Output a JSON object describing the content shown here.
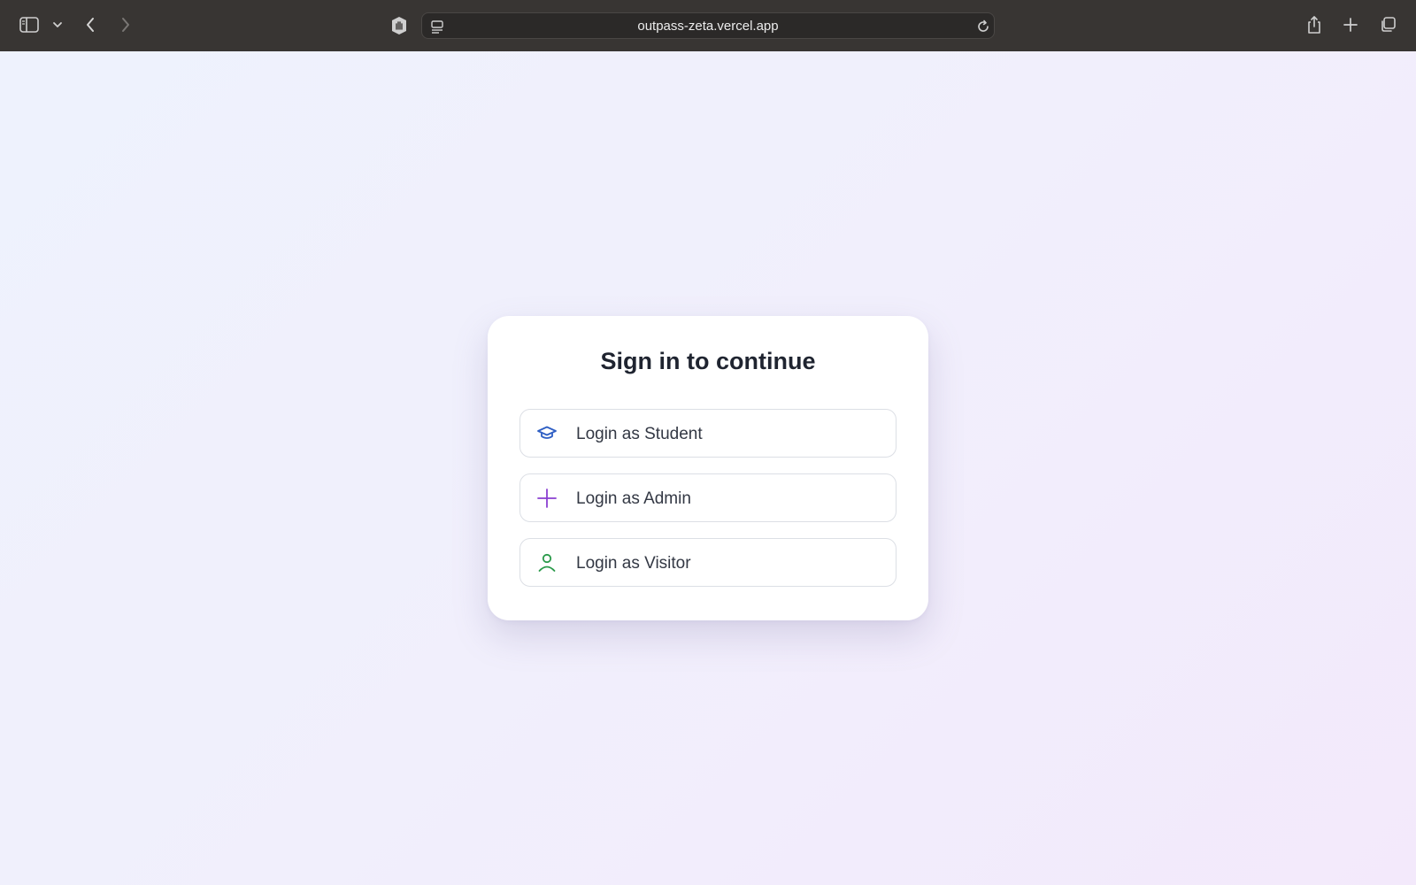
{
  "browser": {
    "url": "outpass-zeta.vercel.app",
    "icons": {
      "sidebar": "sidebar-icon",
      "sidebar_menu": "chevron-down-icon",
      "back": "back-arrow-icon",
      "forward": "forward-arrow-icon",
      "privacy": "hand-shield-icon",
      "page_menu": "page-menu-icon",
      "reload": "reload-icon",
      "share": "share-icon",
      "new_tab": "plus-icon",
      "tabs": "tabs-overview-icon"
    }
  },
  "signin": {
    "title": "Sign in to continue",
    "options": [
      {
        "label": "Login as Student",
        "icon": "graduation-cap-icon",
        "color": "#2f5fc4"
      },
      {
        "label": "Login as Admin",
        "icon": "plus-icon",
        "color": "#8a3fd1"
      },
      {
        "label": "Login as Visitor",
        "icon": "user-icon",
        "color": "#2a9a4a"
      }
    ]
  },
  "colors": {
    "toolbar_bg": "#383533",
    "page_bg_start": "#eef2fd",
    "page_bg_end": "#f3e9fb",
    "title_text": "#1f2430"
  }
}
